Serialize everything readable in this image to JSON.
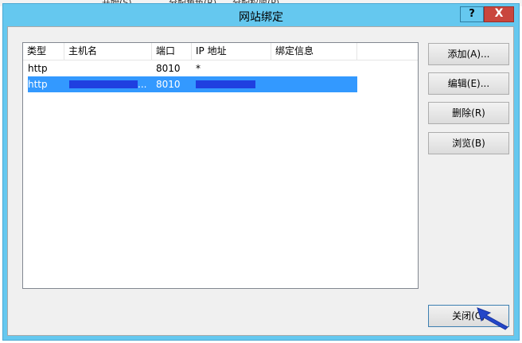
{
  "background": {
    "menu_items": [
      "开始(S)",
      "分配角色(R)",
      "分配权限(P)"
    ]
  },
  "dialog": {
    "title": "网站绑定",
    "help_label": "?",
    "close_label": "X"
  },
  "bindings_table": {
    "columns": [
      "类型",
      "主机名",
      "端口",
      "IP 地址",
      "绑定信息"
    ],
    "rows": [
      {
        "type": "http",
        "host": "",
        "port": "8010",
        "ip": "*",
        "info": "",
        "selected": false
      },
      {
        "type": "http",
        "host": "...",
        "port": "8010",
        "ip": "",
        "info": "",
        "selected": true
      }
    ]
  },
  "buttons": {
    "add": "添加(A)...",
    "edit": "编辑(E)...",
    "remove": "删除(R)",
    "browse": "浏览(B)",
    "close": "关闭(C)"
  },
  "colors": {
    "title_bar": "#65c8ef",
    "selection": "#3399ff",
    "redaction": "#1f3fe0",
    "close_button": "#c9463d"
  }
}
